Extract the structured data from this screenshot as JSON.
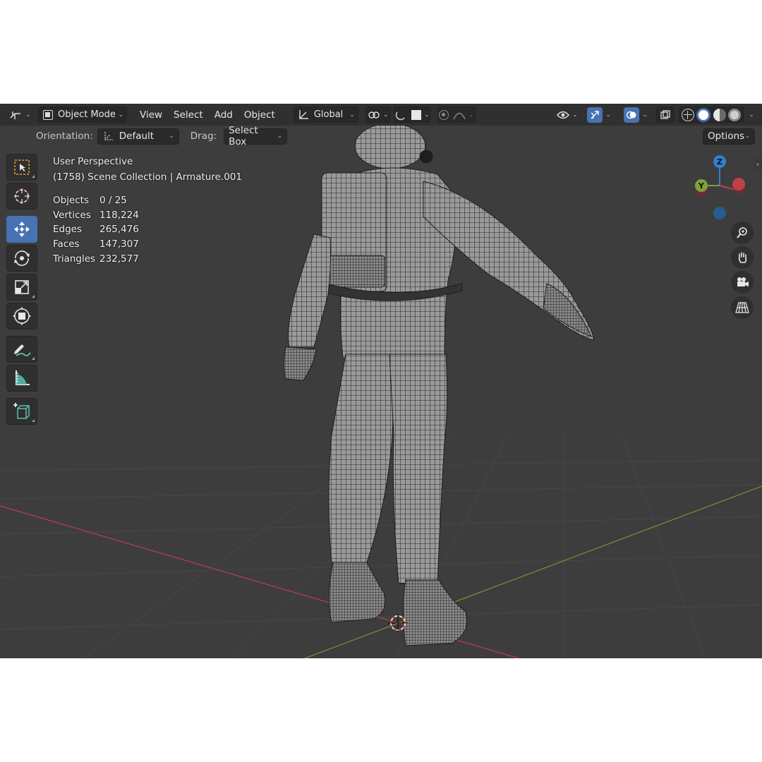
{
  "header": {
    "mode_label": "Object Mode",
    "menus": [
      "View",
      "Select",
      "Add",
      "Object"
    ],
    "transform_orientation": "Global"
  },
  "tool_header": {
    "orientation_label": "Orientation:",
    "orientation_value": "Default",
    "drag_label": "Drag:",
    "drag_value": "Select Box",
    "options_label": "Options"
  },
  "overlay": {
    "perspective": "User Perspective",
    "collection": "(1758) Scene Collection | Armature.001",
    "stats": [
      {
        "label": "Objects",
        "value": "0 / 25"
      },
      {
        "label": "Vertices",
        "value": "118,224"
      },
      {
        "label": "Edges",
        "value": "265,476"
      },
      {
        "label": "Faces",
        "value": "147,307"
      },
      {
        "label": "Triangles",
        "value": "232,577"
      }
    ]
  },
  "gizmo": {
    "z_label": "Z",
    "y_label": "Y"
  },
  "toolbar": {
    "tools": [
      "select-box-tool",
      "cursor-tool",
      "move-tool",
      "rotate-tool",
      "scale-tool",
      "transform-tool",
      "annotate-tool",
      "measure-tool",
      "add-cube-tool"
    ],
    "active_tool": "move-tool"
  },
  "colors": {
    "accent": "#4772b3",
    "x_axis": "#c0404a",
    "y_axis": "#7aa33a",
    "z_axis": "#2f7fd0",
    "viewport_bg": "#3d3d3d",
    "header_bg": "#303030"
  }
}
